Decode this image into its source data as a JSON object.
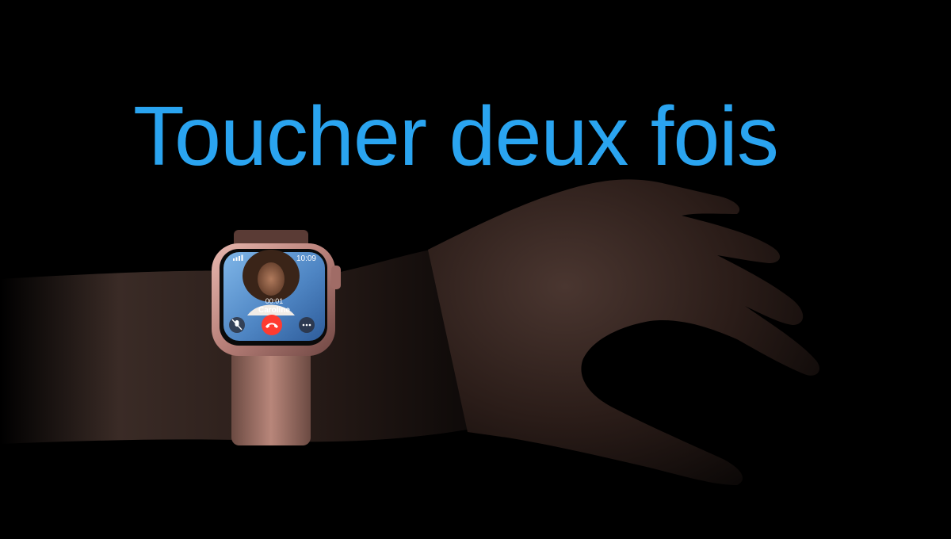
{
  "headline": "Toucher deux fois",
  "colors": {
    "background": "#000000",
    "headline": "#2aa4f0",
    "end_call": "#ff3b30",
    "watch_case": "#c9918a",
    "band": "#a9786d"
  },
  "watch": {
    "time": "10:09",
    "call_duration": "00:01",
    "caller_name": "Caroline",
    "icons": [
      "signal-icon",
      "mute-icon",
      "end-call-icon",
      "more-icon"
    ]
  }
}
